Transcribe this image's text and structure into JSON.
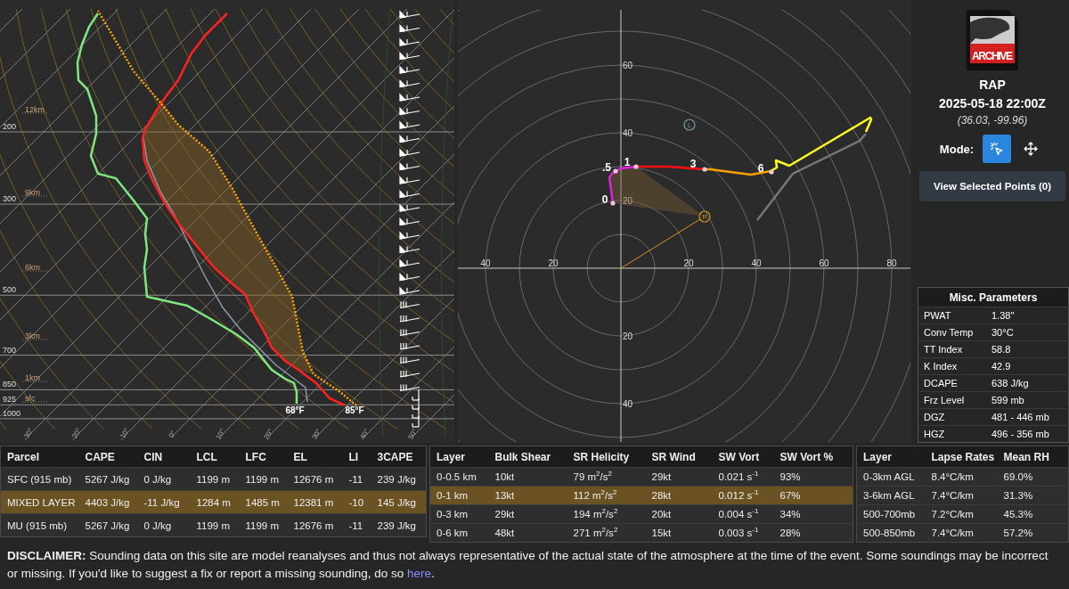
{
  "skew_t": {
    "pressure_labels": [
      "200",
      "300",
      "500",
      "700",
      "850",
      "925",
      "1000"
    ],
    "height_labels": [
      "12km",
      "9km",
      "6km",
      "3km",
      "1km",
      "sfc"
    ],
    "temperature_labels": [
      "-30°",
      "-20°",
      "-10°",
      "0°",
      "10°",
      "20°",
      "30°",
      "40°",
      "50°"
    ],
    "surface_dewpoint": "68°F",
    "surface_temperature": "85°F"
  },
  "hodograph": {
    "x_labels": [
      "40",
      "20",
      "20",
      "40",
      "60",
      "80"
    ],
    "y_labels": [
      "60",
      "40",
      "20",
      "20",
      "40"
    ],
    "height_labels": [
      ".5",
      "1",
      "3",
      "6",
      "0"
    ],
    "left_mover": "L",
    "right_mover": "R"
  },
  "sidebar": {
    "logo_text": "ARCHIVE",
    "model": "RAP",
    "time": "2025-05-18 22:00Z",
    "location": "(36.03, -99.96)",
    "mode_label": "Mode:",
    "modes": [
      {
        "kind": "select",
        "selected": true
      },
      {
        "kind": "pan",
        "selected": false
      }
    ],
    "view_button": "View Selected Points (0)",
    "misc": {
      "title": "Misc. Parameters",
      "rows": [
        [
          "PWAT",
          "1.38\""
        ],
        [
          "Conv Temp",
          "30°C"
        ],
        [
          "TT Index",
          "58.8"
        ],
        [
          "K Index",
          "42.9"
        ],
        [
          "DCAPE",
          "638 J/kg"
        ],
        [
          "Frz Level",
          "599 mb"
        ],
        [
          "DGZ",
          "481 - 446 mb"
        ],
        [
          "HGZ",
          "496 - 356 mb"
        ]
      ]
    }
  },
  "parcel_table": {
    "columns": [
      "Parcel",
      "CAPE",
      "CIN",
      "LCL",
      "LFC",
      "EL",
      "LI",
      "3CAPE"
    ],
    "rows": [
      {
        "cells": [
          "SFC (915 mb)",
          "5267 J/kg",
          "0 J/kg",
          "1199 m",
          "1199 m",
          "12676 m",
          "-11",
          "239 J/kg"
        ],
        "selected": false
      },
      {
        "cells": [
          "MIXED LAYER",
          "4403 J/kg",
          "-11 J/kg",
          "1284 m",
          "1485 m",
          "12381 m",
          "-10",
          "145 J/kg"
        ],
        "selected": true
      },
      {
        "cells": [
          "MU (915 mb)",
          "5267 J/kg",
          "0 J/kg",
          "1199 m",
          "1199 m",
          "12676 m",
          "-11",
          "239 J/kg"
        ],
        "selected": false
      }
    ]
  },
  "shear_table": {
    "columns": [
      "Layer",
      "Bulk Shear",
      "SR Helicity",
      "SR Wind",
      "SW Vort",
      "SW Vort %"
    ],
    "rows": [
      {
        "cells": [
          "0-0.5 km",
          "10kt",
          "79 m$^{2}$/s$^{2}$",
          "29kt",
          "0.021 s$^{-1}$",
          "93%"
        ],
        "selected": false
      },
      {
        "cells": [
          "0-1 km",
          "13kt",
          "112 m$^{2}$/s$^{2}$",
          "28kt",
          "0.012 s$^{-1}$",
          "67%"
        ],
        "selected": true
      },
      {
        "cells": [
          "0-3 km",
          "29kt",
          "194 m$^{2}$/s$^{2}$",
          "20kt",
          "0.004 s$^{-1}$",
          "34%"
        ],
        "selected": false
      },
      {
        "cells": [
          "0-6 km",
          "48kt",
          "271 m$^{2}$/s$^{2}$",
          "15kt",
          "0.003 s$^{-1}$",
          "28%"
        ],
        "selected": false
      }
    ]
  },
  "lapse_table": {
    "columns": [
      "Layer",
      "Lapse Rates",
      "Mean RH"
    ],
    "rows": [
      {
        "cells": [
          "0-3km AGL",
          "8.4°C/km",
          "69.0%"
        ],
        "selected": false
      },
      {
        "cells": [
          "3-6km AGL",
          "7.4°C/km",
          "31.3%"
        ],
        "selected": false
      },
      {
        "cells": [
          "500-700mb",
          "7.2°C/km",
          "45.3%"
        ],
        "selected": false
      },
      {
        "cells": [
          "500-850mb",
          "7.4°C/km",
          "57.2%"
        ],
        "selected": false
      }
    ]
  },
  "disclaimer": {
    "text": "**DISCLAIMER:** Sounding data on this site are model reanalyses and thus not always representative of the actual state of the atmosphere at the time of the event. Some soundings may be incorrect or missing. If you'd like to suggest a fix or report a missing sounding, do so ",
    "link": "here",
    "end": "."
  }
}
